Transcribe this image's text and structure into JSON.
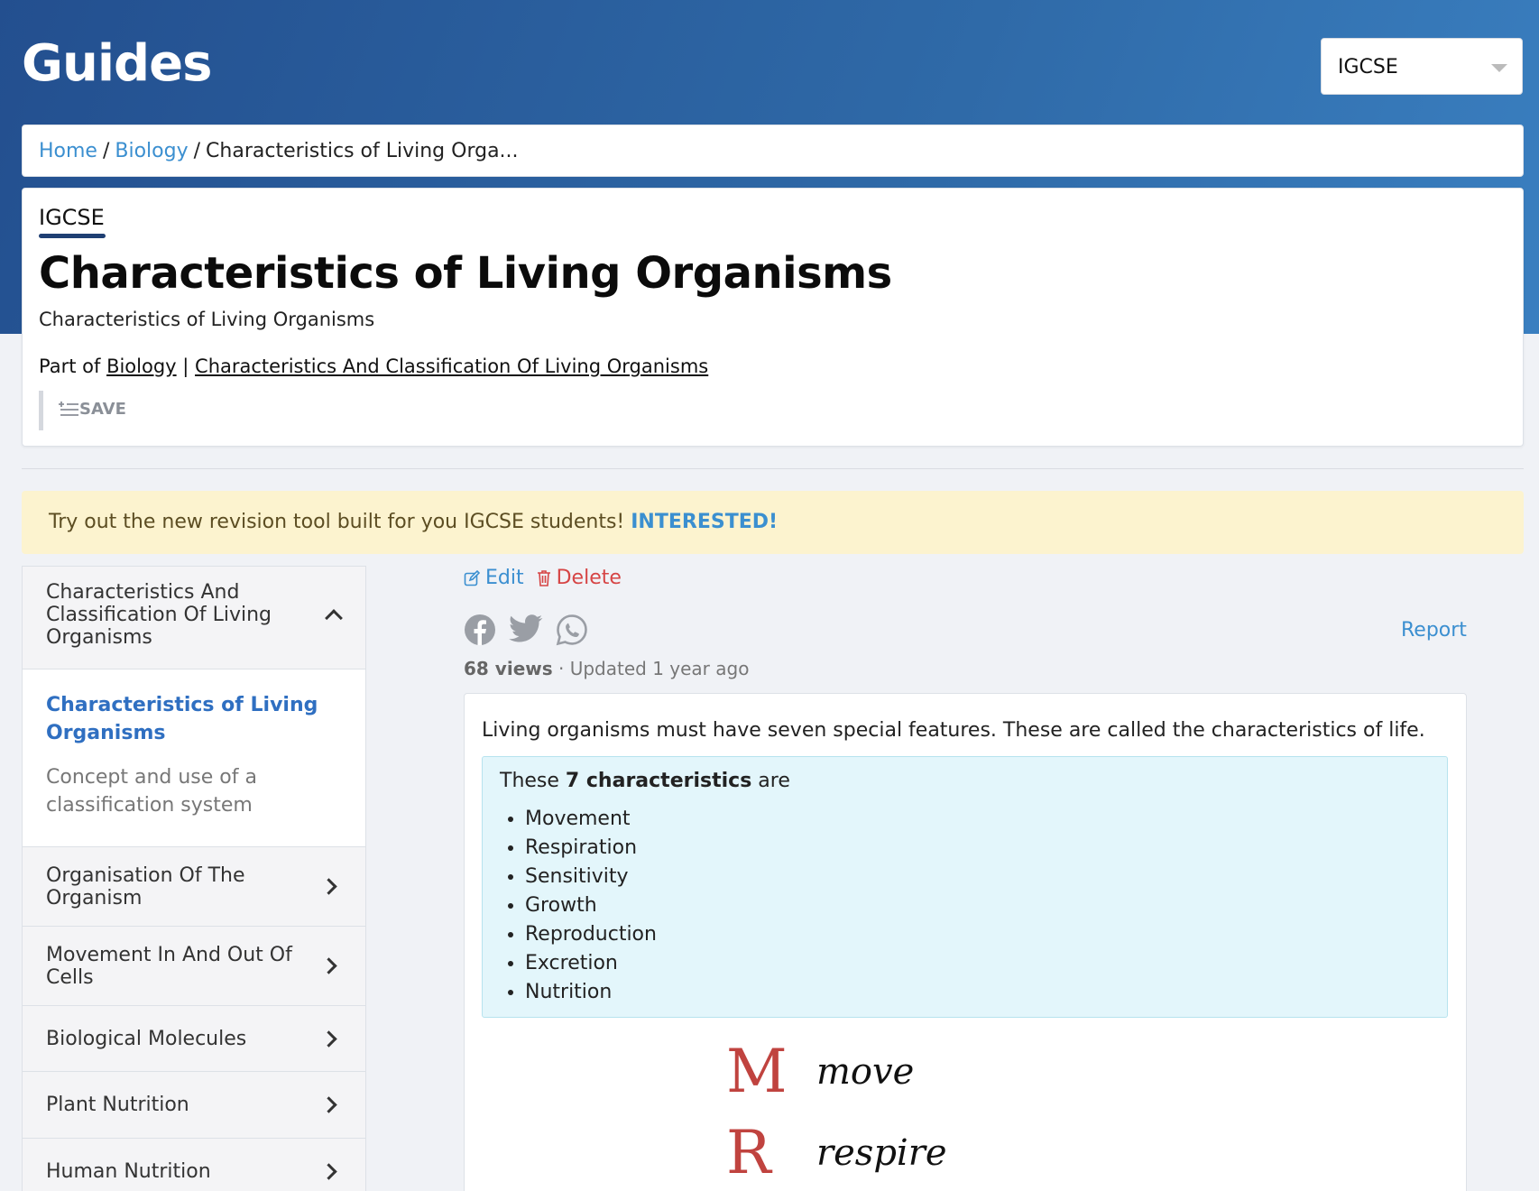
{
  "header": {
    "brand": "Guides",
    "level_select": "IGCSE"
  },
  "breadcrumb": {
    "home": "Home",
    "subject": "Biology",
    "current": "Characteristics of Living Orga..."
  },
  "article": {
    "level": "IGCSE",
    "title": "Characteristics of Living Organisms",
    "subtitle": "Characteristics of Living Organisms",
    "part_of_label": "Part of",
    "part_of_subject": "Biology",
    "part_of_divider": "|",
    "part_of_topic": "Characteristics And Classification Of Living Organisms",
    "save_label": "SAVE"
  },
  "banner": {
    "text": "Try out the new revision tool built for you IGCSE students!",
    "cta": "INTERESTED!"
  },
  "sidebar": {
    "open_section": "Characteristics And Classification Of Living Organisms",
    "open_items": [
      "Characteristics of Living Organisms",
      "Concept and use of a classification system"
    ],
    "sections": [
      "Organisation Of The Organism",
      "Movement In And Out Of Cells",
      "Biological Molecules",
      "Plant Nutrition",
      "Human Nutrition"
    ]
  },
  "actions": {
    "edit": "Edit",
    "delete": "Delete",
    "report": "Report"
  },
  "meta": {
    "views": "68 views",
    "updated": " · Updated 1 year ago"
  },
  "content": {
    "intro": "Living organisms must have seven special features. These are called the characteristics of life.",
    "box_prefix": "These ",
    "box_bold": "7 characteristics",
    "box_suffix": " are",
    "characteristics": [
      "Movement",
      "Respiration",
      "Sensitivity",
      "Growth",
      "Reproduction",
      "Excretion",
      "Nutrition"
    ],
    "mnemonic": [
      {
        "letter": "M",
        "word": "move"
      },
      {
        "letter": "R",
        "word": "respire"
      }
    ]
  },
  "colors": {
    "accent": "#3b8fd0",
    "danger": "#d64545",
    "header": "#2a5c9c",
    "banner": "#fcf3cf",
    "info": "#e3f6fb"
  }
}
